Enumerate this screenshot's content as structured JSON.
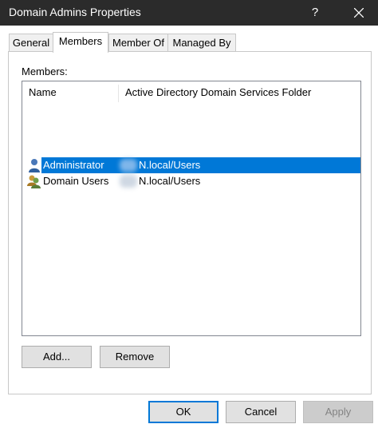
{
  "window": {
    "title": "Domain Admins Properties",
    "help_glyph": "?",
    "close_icon": "close-icon"
  },
  "tabs": [
    {
      "label": "General",
      "active": false
    },
    {
      "label": "Members",
      "active": true
    },
    {
      "label": "Member Of",
      "active": false
    },
    {
      "label": "Managed By",
      "active": false
    }
  ],
  "members": {
    "label": "Members:",
    "columns": [
      "Name",
      "Active Directory Domain Services Folder"
    ],
    "rows": [
      {
        "name": "Administrator",
        "folder": "N.local/Users",
        "icon": "user-icon",
        "selected": true
      },
      {
        "name": "Domain Users",
        "folder": "N.local/Users",
        "icon": "group-icon",
        "selected": false
      }
    ],
    "selection_color": "#0078d7"
  },
  "actions": {
    "add_label": "Add...",
    "remove_label": "Remove"
  },
  "footer": {
    "ok_label": "OK",
    "cancel_label": "Cancel",
    "apply_label": "Apply"
  }
}
